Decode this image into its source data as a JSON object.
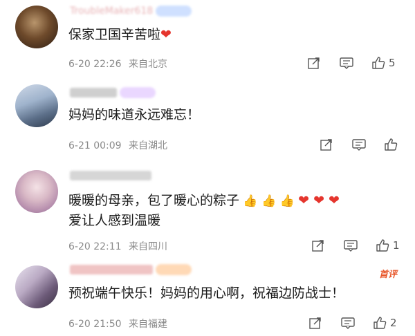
{
  "comments": [
    {
      "username": "TroubleMaker618",
      "text": "保家卫国辛苦啦",
      "emoji": "❤️",
      "date": "6-20 22:26",
      "location": "来自北京",
      "likes": "5"
    },
    {
      "username": "",
      "text": "妈妈的味道永远难忘！",
      "date": "6-21 00:09",
      "location": "来自湖北",
      "likes": ""
    },
    {
      "username": "",
      "text_line1": "暖暖的母亲，包了暖心的粽子",
      "emojis": "👍👍👍❤️❤️❤️",
      "text_line2": "爱让人感到温暖",
      "date": "6-20 22:11",
      "location": "来自四川",
      "likes": "1"
    },
    {
      "username": "",
      "text": "预祝端午快乐！妈妈的用心啊，祝福边防战士！",
      "date": "6-20 21:50",
      "location": "来自福建",
      "likes": "2",
      "tag": "首评"
    }
  ],
  "colors": {
    "accent": "#e8572b",
    "heart": "#e5352d",
    "meta": "#8a8a8a"
  }
}
